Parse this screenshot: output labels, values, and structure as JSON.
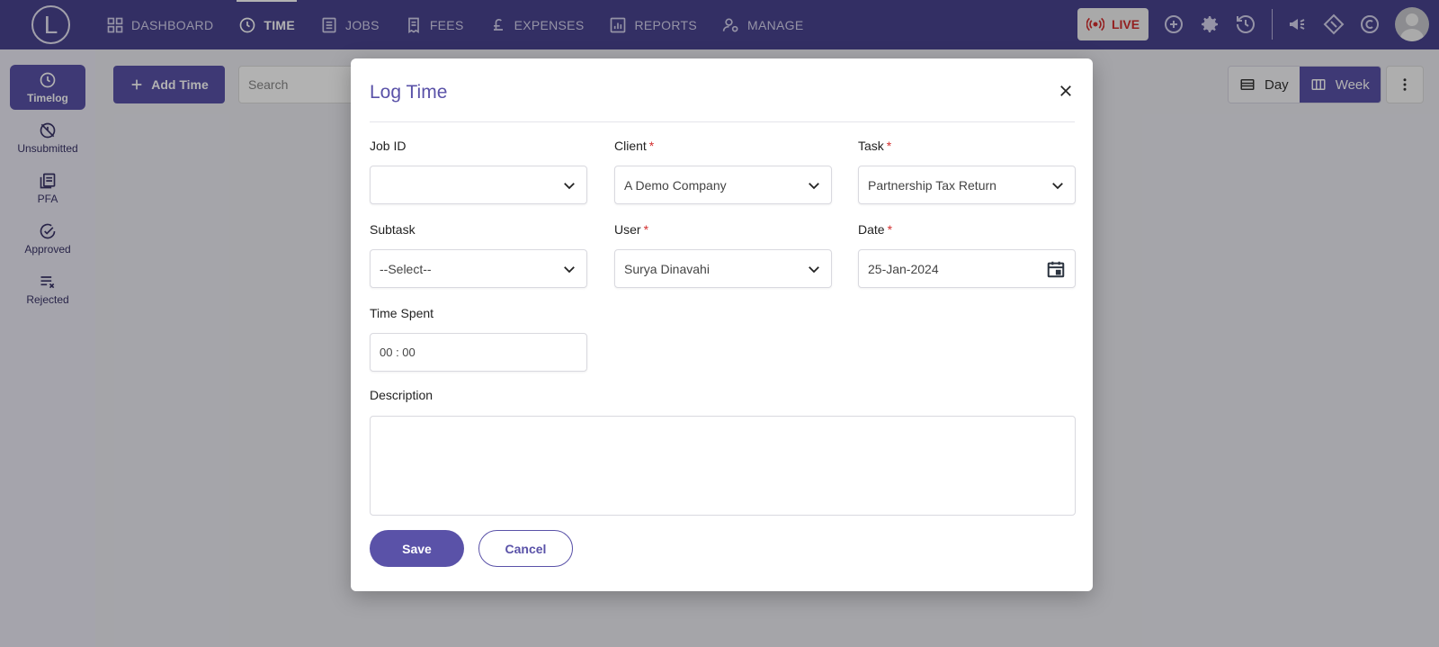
{
  "logo": {
    "letter": "L"
  },
  "nav": [
    {
      "label": "DASHBOARD",
      "icon": "grid-icon",
      "active": false
    },
    {
      "label": "TIME",
      "icon": "clock-icon",
      "active": true
    },
    {
      "label": "JOBS",
      "icon": "list-icon",
      "active": false
    },
    {
      "label": "FEES",
      "icon": "receipt-icon",
      "active": false
    },
    {
      "label": "EXPENSES",
      "icon": "pound-icon",
      "active": false
    },
    {
      "label": "REPORTS",
      "icon": "chart-icon",
      "active": false
    },
    {
      "label": "MANAGE",
      "icon": "user-gear-icon",
      "active": false
    }
  ],
  "topbar": {
    "live_label": "LIVE",
    "accent": "#4a4490",
    "live_color": "#d32f2f"
  },
  "sidebar": {
    "items": [
      {
        "label": "Timelog",
        "icon": "clock-icon",
        "active": true
      },
      {
        "label": "Unsubmitted",
        "icon": "unsubmitted-icon",
        "active": false
      },
      {
        "label": "PFA",
        "icon": "pfa-icon",
        "active": false
      },
      {
        "label": "Approved",
        "icon": "check-circle-icon",
        "active": false
      },
      {
        "label": "Rejected",
        "icon": "rejected-list-icon",
        "active": false
      }
    ]
  },
  "toolbar": {
    "add_time_label": "Add Time",
    "search_placeholder": "Search",
    "day_label": "Day",
    "week_label": "Week"
  },
  "modal": {
    "title": "Log Time",
    "fields": {
      "job_id": {
        "label": "Job ID",
        "value": "",
        "required": false
      },
      "client": {
        "label": "Client",
        "value": "A Demo Company",
        "required": true
      },
      "task": {
        "label": "Task",
        "value": "Partnership Tax Return",
        "required": true
      },
      "subtask": {
        "label": "Subtask",
        "value": "--Select--",
        "required": false
      },
      "user": {
        "label": "User",
        "value": "Surya Dinavahi",
        "required": true
      },
      "date": {
        "label": "Date",
        "value": "25-Jan-2024",
        "required": true
      },
      "time_spent": {
        "label": "Time Spent",
        "value": "00 : 00",
        "required": false
      },
      "description": {
        "label": "Description",
        "value": "",
        "required": false
      }
    },
    "required_mark": "*",
    "save_label": "Save",
    "cancel_label": "Cancel",
    "primary_color": "#5a52a8"
  }
}
